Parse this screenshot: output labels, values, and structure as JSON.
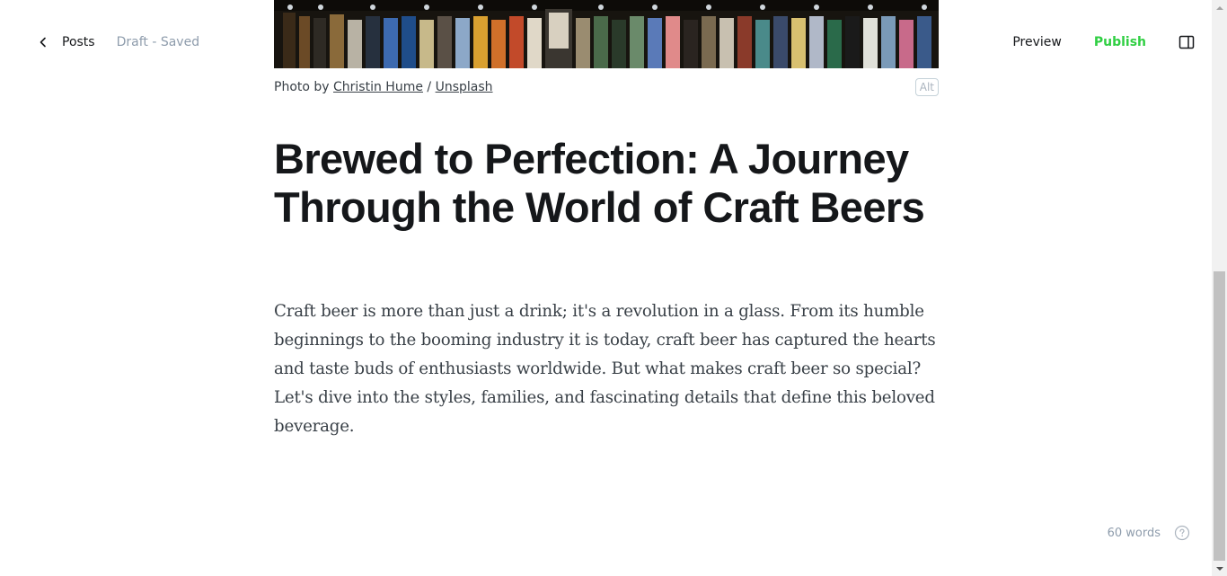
{
  "header": {
    "back_label": "Posts",
    "status": "Draft - Saved",
    "preview_label": "Preview",
    "publish_label": "Publish",
    "back_icon": "chevron-left-icon",
    "sidebar_icon": "sidebar-toggle-icon"
  },
  "feature_image": {
    "caption_prefix": "Photo by",
    "author": "Christin Hume",
    "separator": "/",
    "source": "Unsplash",
    "alt_label": "Alt"
  },
  "post": {
    "title": "Brewed to Perfection: A Journey Through the World of Craft Beers",
    "body": "Craft beer is more than just a drink; it's a revolution in a glass. From its humble beginnings to the booming industry it is today, craft beer has captured the hearts and taste buds of enthusiasts worldwide. But what makes craft beer so special? Let's dive into the styles, families, and fascinating details that define this beloved beverage."
  },
  "footer": {
    "word_count": "60 words",
    "help_icon": "help-circle-icon"
  },
  "colors": {
    "publish": "#30cf43",
    "muted": "#8e9cac",
    "text": "#15171a"
  }
}
